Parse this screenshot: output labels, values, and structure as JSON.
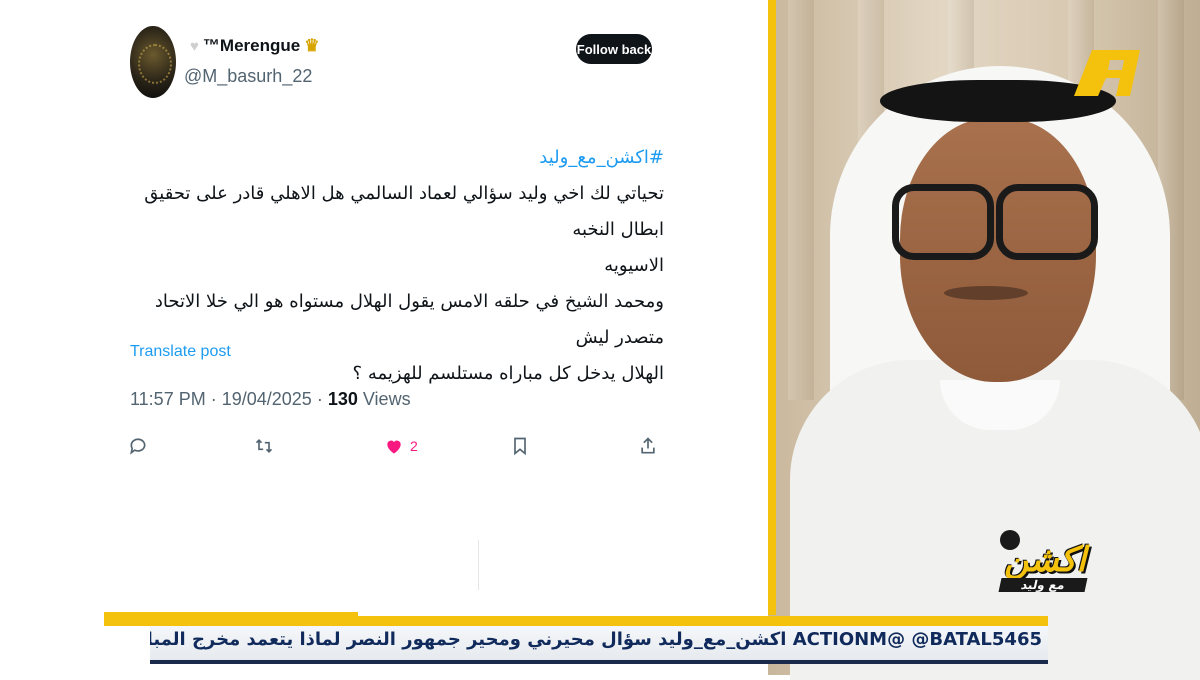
{
  "tweet": {
    "display_name": "™Merengue",
    "handle": "@M_basurh_22",
    "follow_label": "Follow back",
    "hashtag": "#اكشن_مع_وليد",
    "lines": [
      "تحياتي لك اخي وليد سؤالي لعماد السالمي هل الاهلي قادر على تحقيق ابطال النخبه",
      "الاسيويه",
      "ومحمد الشيخ في حلقه الامس يقول الهلال مستواه  هو الي خلا الاتحاد متصدر ليش",
      "الهلال يدخل كل مباراه مستلسم للهزيمه ؟"
    ],
    "translate_label": "Translate post",
    "time": "11:57 PM",
    "date": "19/04/2025",
    "views_count": "130",
    "views_label": "Views",
    "like_count": "2"
  },
  "overlay": {
    "show_logo_text": "اكشن",
    "show_logo_sub": "مع وليد",
    "ticker": "ACTIONM@ @BATAL5465 اكشن_مع_وليد سؤال محيرني ومحير جمهور النصر لماذا يتعمد مخرج المباريات عندما يتم تس"
  },
  "colors": {
    "accent_yellow": "#f4c20d",
    "link_blue": "#1d9bf0",
    "like_pink": "#f91880",
    "ticker_text": "#102a5c"
  },
  "icons": [
    "heart-badge-icon",
    "crown-icon",
    "reply-icon",
    "retweet-icon",
    "like-icon",
    "bookmark-icon",
    "share-icon"
  ]
}
